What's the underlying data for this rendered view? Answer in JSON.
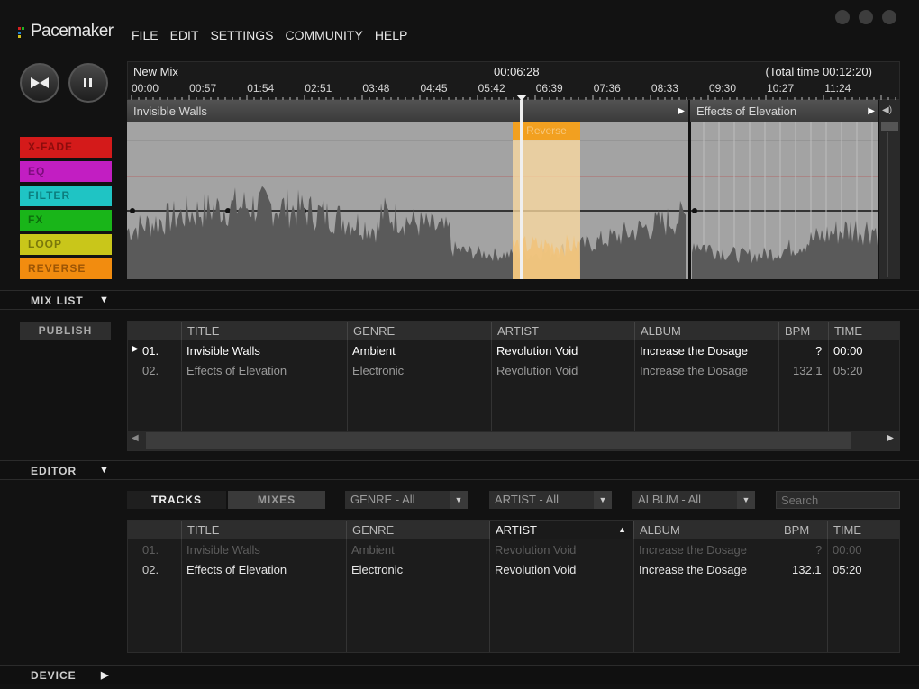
{
  "app": {
    "logo": "Pacemaker"
  },
  "menu": [
    "FILE",
    "EDIT",
    "SETTINGS",
    "COMMUNITY",
    "HELP"
  ],
  "effects": [
    "X-FADE",
    "EQ",
    "FILTER",
    "FX",
    "LOOP",
    "REVERSE"
  ],
  "timeline": {
    "mix_name": "New Mix",
    "current_time": "00:06:28",
    "total_time": "(Total time 00:12:20)",
    "ticks": [
      "00:00",
      "00:57",
      "01:54",
      "02:51",
      "03:48",
      "04:45",
      "05:42",
      "06:39",
      "07:36",
      "08:33",
      "09:30",
      "10:27",
      "11:24"
    ],
    "playhead_fraction": 0.524
  },
  "tracks_lane": [
    {
      "name": "Invisible Walls",
      "fraction_start": 0.0,
      "fraction_end": 0.745
    },
    {
      "name": "Effects of Elevation",
      "fraction_start": 0.745,
      "fraction_end": 1.0
    }
  ],
  "reverse_label": "Reverse",
  "sections": {
    "mix_list": "MIX LIST",
    "editor": "EDITOR",
    "device": "DEVICE"
  },
  "mix_list": {
    "publish": "PUBLISH",
    "columns": [
      "TITLE",
      "GENRE",
      "ARTIST",
      "ALBUM",
      "BPM",
      "TIME"
    ],
    "rows": [
      {
        "num": "01.",
        "title": "Invisible Walls",
        "genre": "Ambient",
        "artist": "Revolution Void",
        "album": "Increase the Dosage",
        "bpm": "?",
        "time": "00:00"
      },
      {
        "num": "02.",
        "title": "Effects of Elevation",
        "genre": "Electronic",
        "artist": "Revolution Void",
        "album": "Increase the Dosage",
        "bpm": "132.1",
        "time": "05:20"
      }
    ]
  },
  "editor": {
    "tab_tracks": "TRACKS",
    "tab_mixes": "MIXES",
    "genre_filter": "GENRE - All",
    "artist_filter": "ARTIST - All",
    "album_filter": "ALBUM - All",
    "search_placeholder": "Search",
    "columns": [
      "TITLE",
      "GENRE",
      "ARTIST",
      "ALBUM",
      "BPM",
      "TIME"
    ],
    "rows": [
      {
        "num": "01.",
        "title": "Invisible Walls",
        "genre": "Ambient",
        "artist": "Revolution Void",
        "album": "Increase the Dosage",
        "bpm": "?",
        "time": "00:00"
      },
      {
        "num": "02.",
        "title": "Effects of Elevation",
        "genre": "Electronic",
        "artist": "Revolution Void",
        "album": "Increase the Dosage",
        "bpm": "132.1",
        "time": "05:20"
      }
    ]
  },
  "colors": {
    "xfade": "#d41a1a",
    "eq": "#c21ec2",
    "filter": "#1fc4c4",
    "fx": "#19b519",
    "loop": "#c9c61a",
    "reverse": "#f28c0f"
  }
}
